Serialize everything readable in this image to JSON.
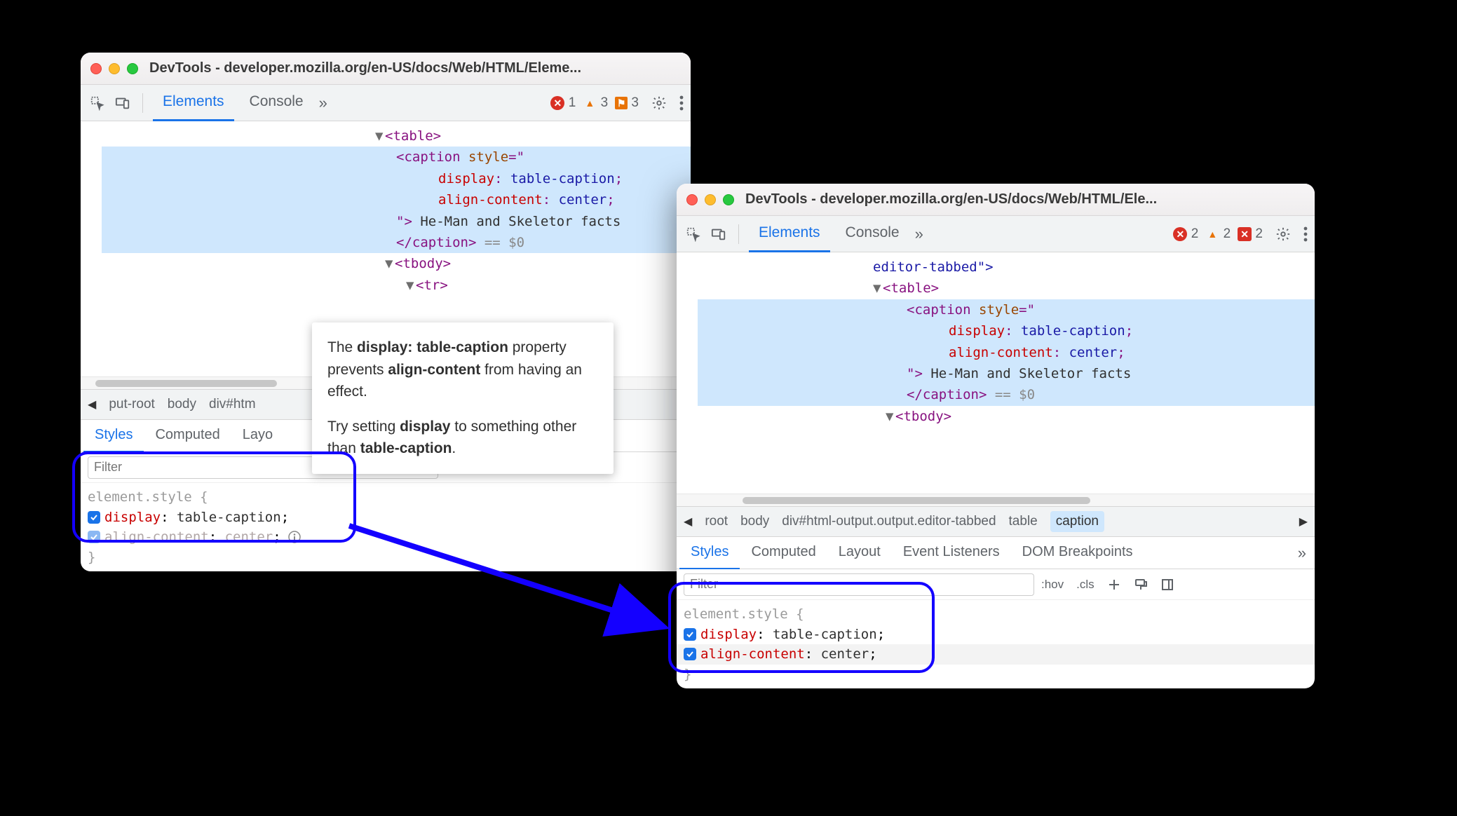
{
  "window1": {
    "title": "DevTools - developer.mozilla.org/en-US/docs/Web/HTML/Eleme...",
    "tabs": {
      "elements": "Elements",
      "console": "Console"
    },
    "status": {
      "errors": "1",
      "warnings": "3",
      "issues": "3"
    },
    "dom": {
      "table_open": "<table>",
      "caption_open": "<caption",
      "style_attr": "style",
      "style_eq": "=\"",
      "prop1": "display",
      "val1": "table-caption",
      "prop2": "align-content",
      "val2": "center",
      "style_close": "\">",
      "caption_text": " He-Man and Skeletor facts",
      "caption_end": "</caption>",
      "eq0": " == $0",
      "tbody": "<tbody>",
      "tr": "<tr>"
    },
    "breadcrumb": {
      "partial0": "put-root",
      "item1": "body",
      "item2": "div#htm"
    },
    "subtabs": {
      "styles": "Styles",
      "computed": "Computed",
      "layout": "Layo"
    },
    "filter_placeholder": "Filter",
    "styles": {
      "selector": "element.style {",
      "rule1_name": "display",
      "rule1_val": "table-caption",
      "rule2_name": "align-content",
      "rule2_val": "center",
      "close": "}"
    }
  },
  "tooltip": {
    "line1a": "The ",
    "line1b": "display: table-caption",
    "line1c": " property prevents ",
    "line1d": "align-content",
    "line1e": " from having an effect.",
    "line2a": "Try setting ",
    "line2b": "display",
    "line2c": " to something other than ",
    "line2d": "table-caption",
    "line2e": "."
  },
  "window2": {
    "title": "DevTools - developer.mozilla.org/en-US/docs/Web/HTML/Ele...",
    "tabs": {
      "elements": "Elements",
      "console": "Console"
    },
    "status": {
      "errors": "2",
      "warnings": "2",
      "issues": "2"
    },
    "dom": {
      "prev_line": "editor-tabbed\">",
      "table_open": "<table>",
      "caption_open": "<caption",
      "style_attr": "style",
      "style_eq": "=\"",
      "prop1": "display",
      "val1": "table-caption",
      "prop2": "align-content",
      "val2": "center",
      "style_close": "\">",
      "caption_text": " He-Man and Skeletor facts",
      "caption_end": "</caption>",
      "eq0": " == $0",
      "tbody": "<tbody>"
    },
    "breadcrumb": {
      "item0": "root",
      "item1": "body",
      "item2": "div#html-output.output.editor-tabbed",
      "item3": "table",
      "item4": "caption"
    },
    "subtabs": {
      "styles": "Styles",
      "computed": "Computed",
      "layout": "Layout",
      "events": "Event Listeners",
      "dom_bp": "DOM Breakpoints"
    },
    "filter_placeholder": "Filter",
    "filter_tools": {
      "hov": ":hov",
      "cls": ".cls"
    },
    "styles": {
      "selector": "element.style {",
      "rule1_name": "display",
      "rule1_val": "table-caption",
      "rule2_name": "align-content",
      "rule2_val": "center",
      "close": "}"
    }
  }
}
